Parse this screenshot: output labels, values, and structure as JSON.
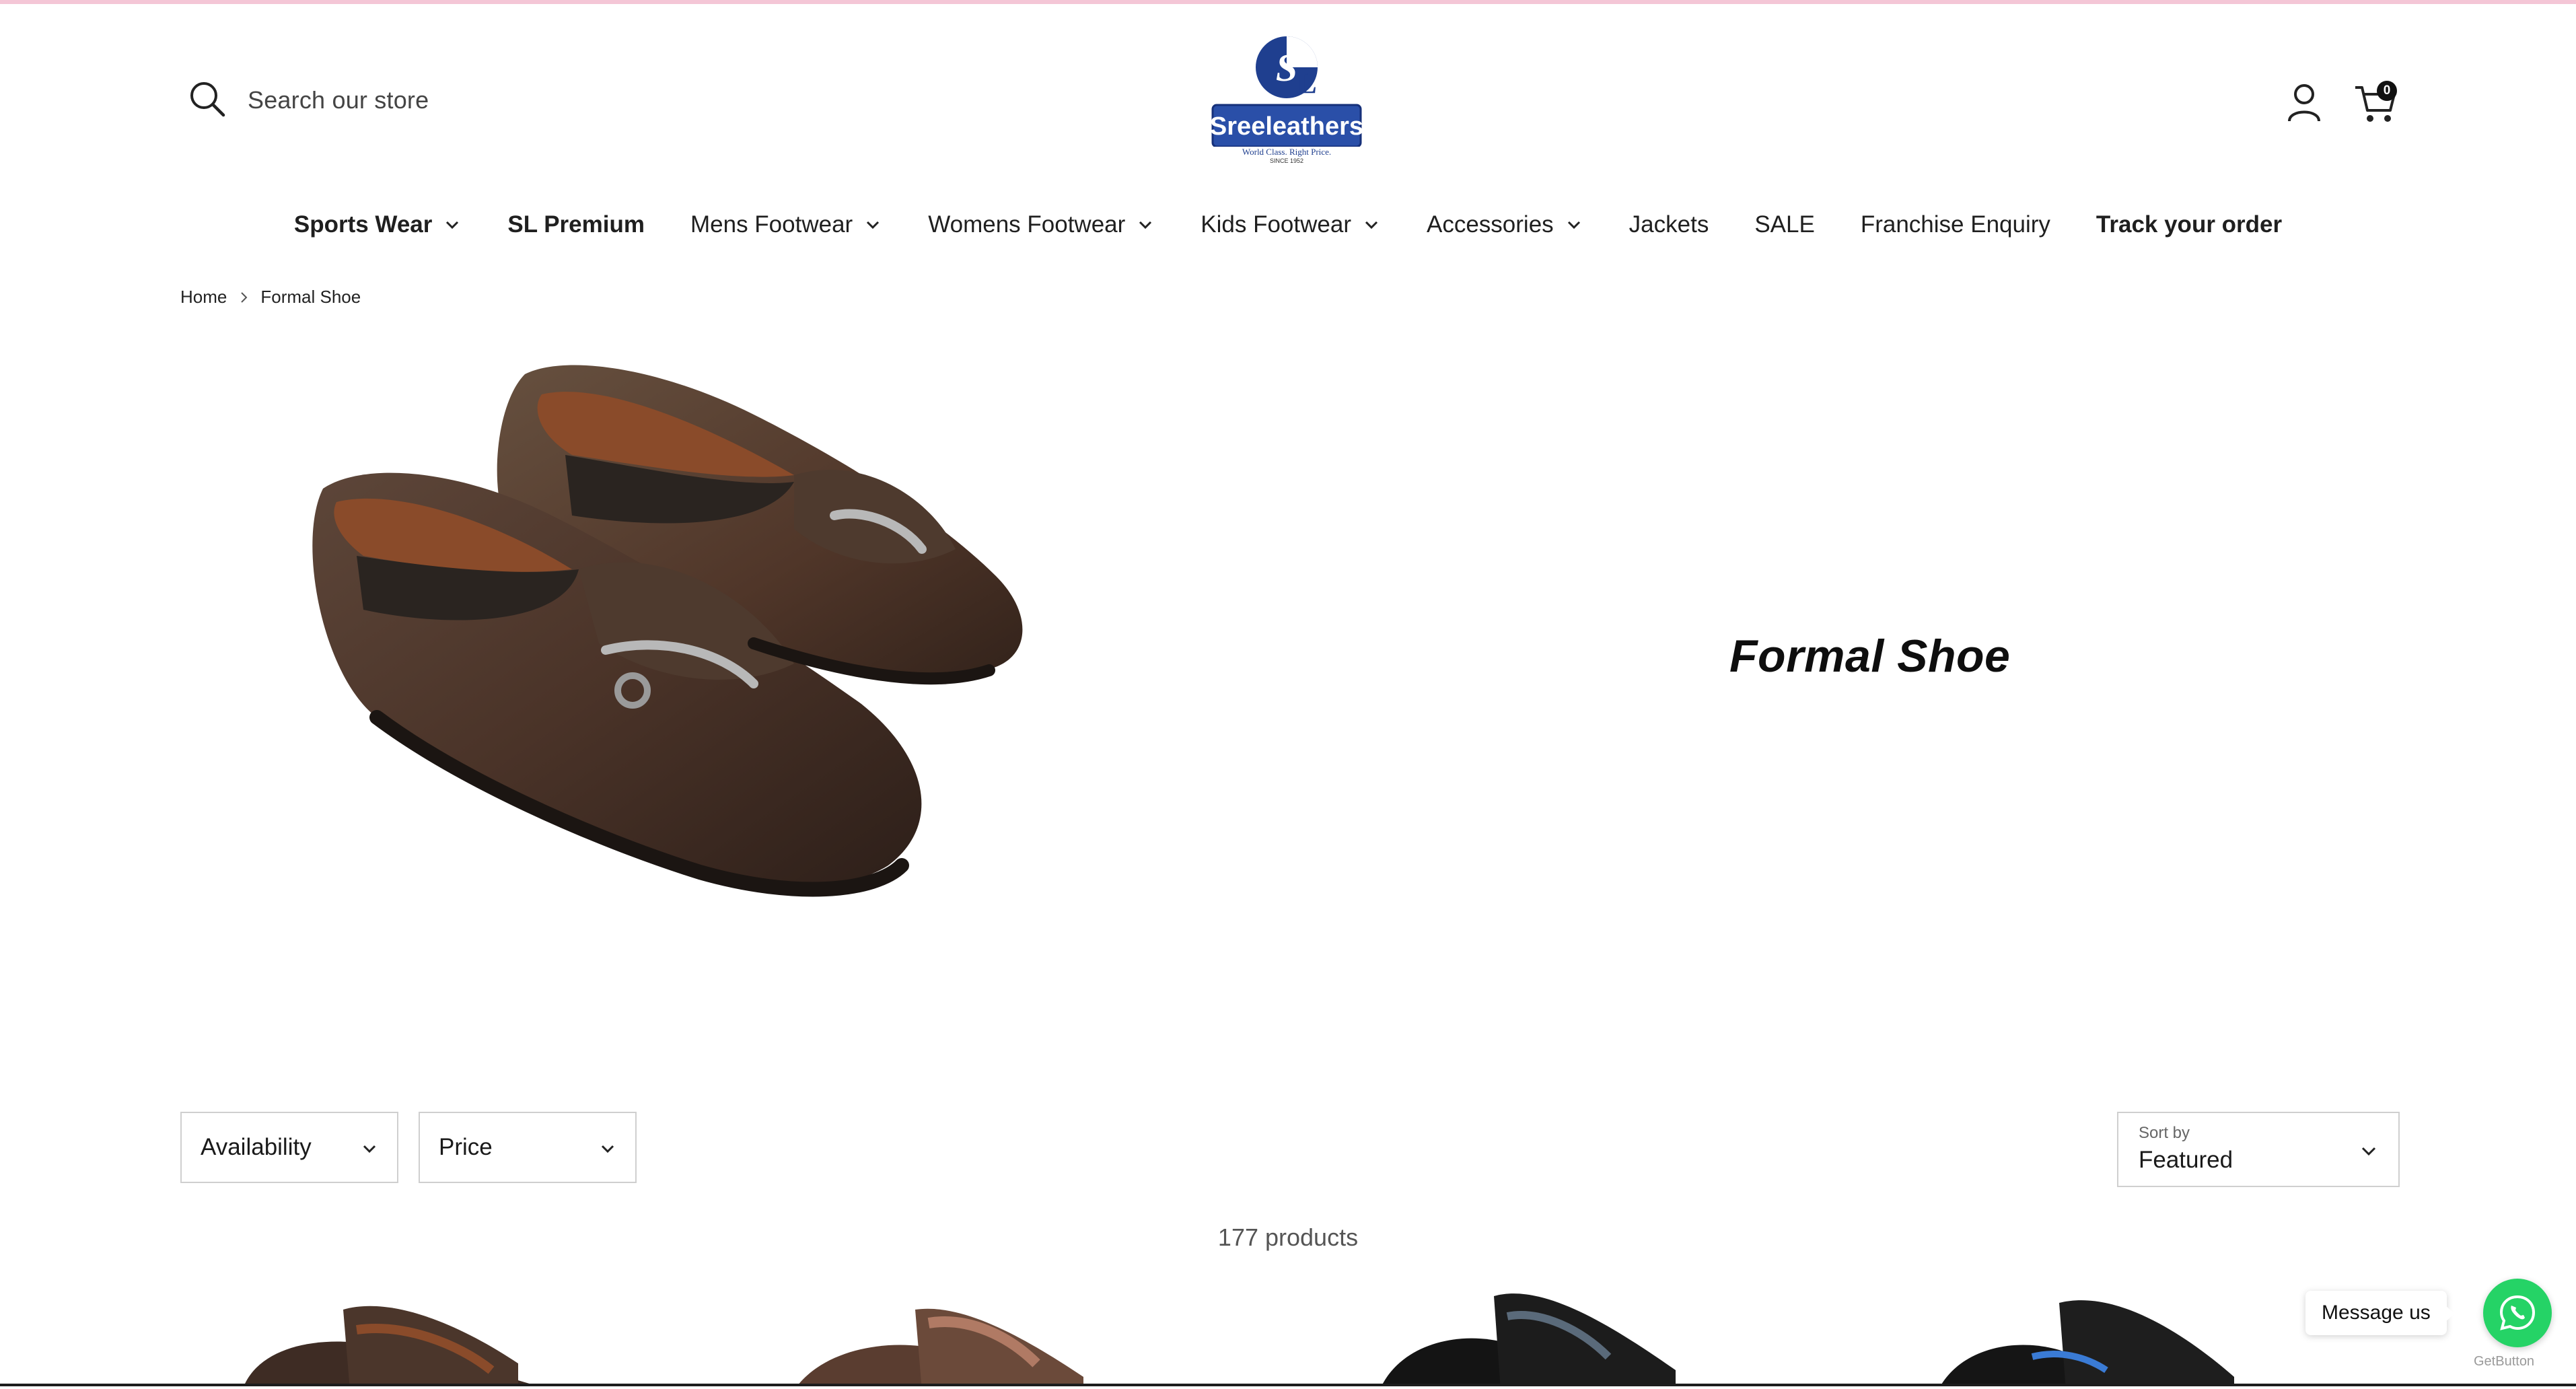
{
  "header": {
    "search_placeholder": "Search our store",
    "logo_text": "Sreeleathers",
    "logo_tagline": "World Class. Right Price.",
    "logo_since": "SINCE 1952",
    "cart_count": "0"
  },
  "nav": {
    "items": [
      {
        "label": "Sports Wear",
        "bold": true,
        "dropdown": true
      },
      {
        "label": "SL Premium",
        "bold": true,
        "dropdown": false
      },
      {
        "label": "Mens Footwear",
        "bold": false,
        "dropdown": true
      },
      {
        "label": "Womens Footwear",
        "bold": false,
        "dropdown": true
      },
      {
        "label": "Kids Footwear",
        "bold": false,
        "dropdown": true
      },
      {
        "label": "Accessories",
        "bold": false,
        "dropdown": true
      },
      {
        "label": "Jackets",
        "bold": false,
        "dropdown": false
      },
      {
        "label": "SALE",
        "bold": false,
        "dropdown": false
      },
      {
        "label": "Franchise Enquiry",
        "bold": false,
        "dropdown": false
      },
      {
        "label": "Track your order",
        "bold": true,
        "dropdown": false
      }
    ]
  },
  "breadcrumb": {
    "home": "Home",
    "current": "Formal Shoe"
  },
  "collection": {
    "title": "Formal Shoe"
  },
  "filters": {
    "availability": "Availability",
    "price": "Price",
    "sort_label": "Sort by",
    "sort_value": "Featured"
  },
  "products": {
    "count_text": "177 products"
  },
  "chat": {
    "message": "Message us",
    "powered": "GetButton"
  },
  "colors": {
    "accent_strip": "#f4c6d6",
    "logo_blue": "#1f3f8f",
    "whatsapp": "#25d366"
  }
}
